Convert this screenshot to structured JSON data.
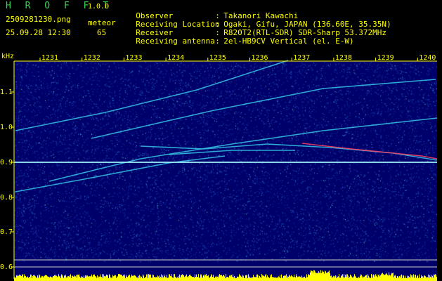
{
  "app": {
    "title": "H R O F F T",
    "version": "1.0.0"
  },
  "file_name": "2509281230.png",
  "timestamp": "25.09.28 12:30",
  "meteor": {
    "label": "meteor",
    "count": "65"
  },
  "info": [
    {
      "key": "Observer",
      "sep": ":",
      "value": "Takanori Kawachi"
    },
    {
      "key": "Receiving Location",
      "sep": ":",
      "value": "Ogaki, Gifu, JAPAN (136.60E, 35.35N)"
    },
    {
      "key": "Receiver",
      "sep": ":",
      "value": "R820T2(RTL-SDR) SDR-Sharp 53.372MHz"
    },
    {
      "key": "Receiving antenna",
      "sep": ":",
      "value": "2el-HB9CV Vertical (el. E-W)"
    }
  ],
  "chart_data": {
    "type": "heatmap",
    "y_unit_label": "kHz",
    "x_ticks": [
      "1231",
      "1232",
      "1233",
      "1234",
      "1235",
      "1236",
      "1237",
      "1238",
      "1239",
      "1240"
    ],
    "y_ticks": [
      "1.1",
      "1.0",
      "0.9",
      "0.8",
      "0.7",
      "0.6"
    ],
    "ylim": [
      0.6,
      1.15
    ],
    "colors": {
      "background": "#00006a",
      "noise": "#1e5bd8",
      "trace": "#35c6e6",
      "strong_echo": "#ff4060",
      "bars": "#ffff00",
      "axis": "#ffff00"
    }
  }
}
